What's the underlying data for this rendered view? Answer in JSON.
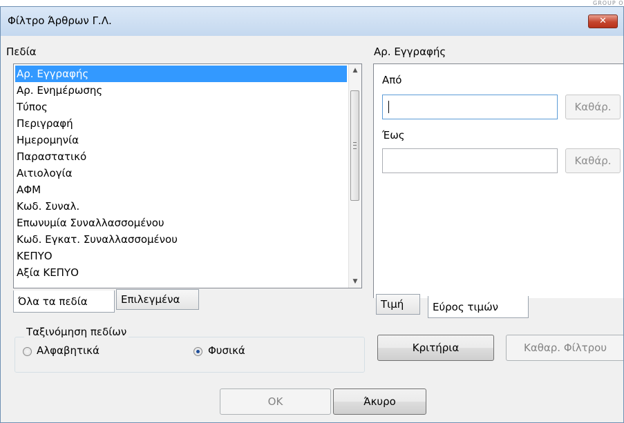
{
  "corner_label": "GROUP O",
  "window": {
    "title": "Φίλτρο Άρθρων Γ.Λ.",
    "close_label": "✕"
  },
  "fields": {
    "label": "Πεδία",
    "items": [
      "Αρ. Εγγραφής",
      "Αρ. Ενημέρωσης",
      "Τύπος",
      "Περιγραφή",
      "Ημερομηνία",
      "Παραστατικό",
      "Αιτιολογία",
      "ΑΦΜ",
      "Κωδ. Συναλ.",
      "Επωνυμία Συναλλασσομένου",
      "Κωδ. Εγκατ. Συναλλασσομένου",
      "ΚΕΠΥΟ",
      "Αξία ΚΕΠΥΟ"
    ],
    "selected_index": 0
  },
  "left_tabs": [
    "Όλα τα πεδία",
    "Επιλεγμένα"
  ],
  "sort": {
    "legend": "Ταξινόμηση πεδίων",
    "options": [
      "Αλφαβητικά",
      "Φυσικά"
    ],
    "selected": "Φυσικά"
  },
  "right": {
    "header": "Αρ. Εγγραφής",
    "from_label": "Από",
    "to_label": "Έως",
    "from_value": "",
    "to_value": "",
    "clear_label": "Καθάρ."
  },
  "right_tabs": [
    "Τιμή",
    "Εύρος τιμών"
  ],
  "buttons": {
    "criteria": "Κριτήρια",
    "clear_filter": "Καθαρ. Φίλτρου",
    "ok": "OK",
    "cancel": "Άκυρο"
  }
}
